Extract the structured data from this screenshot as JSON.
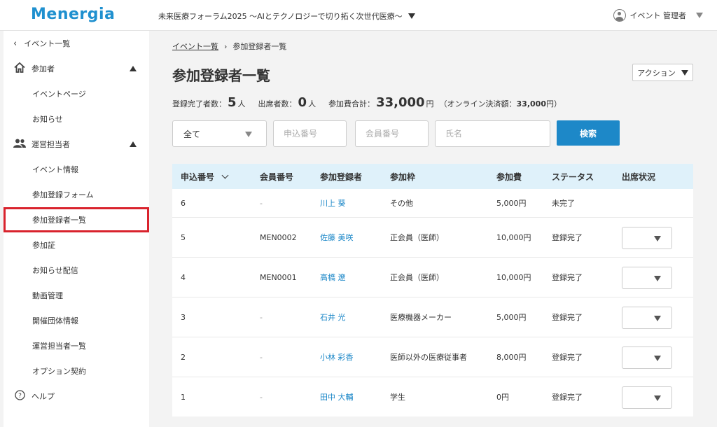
{
  "header": {
    "logo": "Menergia",
    "event_title": "未来医療フォーラム2025 〜AIとテクノロジーで切り拓く次世代医療〜",
    "user_name": "イベント 管理者"
  },
  "sidebar": {
    "back_label": "イベント一覧",
    "sections": [
      {
        "label": "参加者",
        "icon": "home-icon",
        "items": [
          "イベントページ",
          "お知らせ"
        ]
      },
      {
        "label": "運営担当者",
        "icon": "people-icon",
        "items": [
          "イベント情報",
          "参加登録フォーム",
          "参加登録者一覧",
          "参加証",
          "お知らせ配信",
          "動画管理",
          "開催団体情報",
          "運営担当者一覧",
          "オプション契約"
        ]
      }
    ],
    "active_item": "参加登録者一覧",
    "help_label": "ヘルプ"
  },
  "main": {
    "breadcrumb": {
      "parent": "イベント一覧",
      "current": "参加登録者一覧"
    },
    "title": "参加登録者一覧",
    "action_label": "アクション",
    "stats": {
      "registered_label": "登録完了者数：",
      "registered_value": "5",
      "registered_unit": "人",
      "attended_label": "出席者数：",
      "attended_value": "0",
      "attended_unit": "人",
      "fee_label": "参加費合計：",
      "fee_value": "33,000",
      "fee_unit": "円",
      "online_prefix": "（オンライン決済額：",
      "online_value": "33,000",
      "online_suffix": "円）"
    },
    "filter": {
      "status_selected": "全て",
      "app_no_placeholder": "申込番号",
      "member_no_placeholder": "会員番号",
      "name_placeholder": "氏名",
      "search_label": "検索"
    },
    "table": {
      "columns": [
        "申込番号",
        "会員番号",
        "参加登録者",
        "参加枠",
        "参加費",
        "ステータス",
        "出席状況"
      ],
      "rows": [
        {
          "app_no": "6",
          "member_no": "-",
          "name": "川上 葵",
          "category": "その他",
          "fee": "5,000円",
          "status": "未完了",
          "has_attendance": false
        },
        {
          "app_no": "5",
          "member_no": "MEN0002",
          "name": "佐藤 美咲",
          "category": "正会員（医師）",
          "fee": "10,000円",
          "status": "登録完了",
          "has_attendance": true
        },
        {
          "app_no": "4",
          "member_no": "MEN0001",
          "name": "高橋 遼",
          "category": "正会員（医師）",
          "fee": "10,000円",
          "status": "登録完了",
          "has_attendance": true
        },
        {
          "app_no": "3",
          "member_no": "-",
          "name": "石井 光",
          "category": "医療機器メーカー",
          "fee": "5,000円",
          "status": "登録完了",
          "has_attendance": true
        },
        {
          "app_no": "2",
          "member_no": "-",
          "name": "小林 彩香",
          "category": "医師以外の医療従事者",
          "fee": "8,000円",
          "status": "登録完了",
          "has_attendance": true
        },
        {
          "app_no": "1",
          "member_no": "-",
          "name": "田中 大輔",
          "category": "学生",
          "fee": "0円",
          "status": "登録完了",
          "has_attendance": true
        }
      ]
    }
  },
  "colors": {
    "brand": "#1f90cf",
    "primary_button": "#1d88c8",
    "table_header": "#dff1fa",
    "active_outline": "#d9232d",
    "link": "#1d88c8"
  }
}
